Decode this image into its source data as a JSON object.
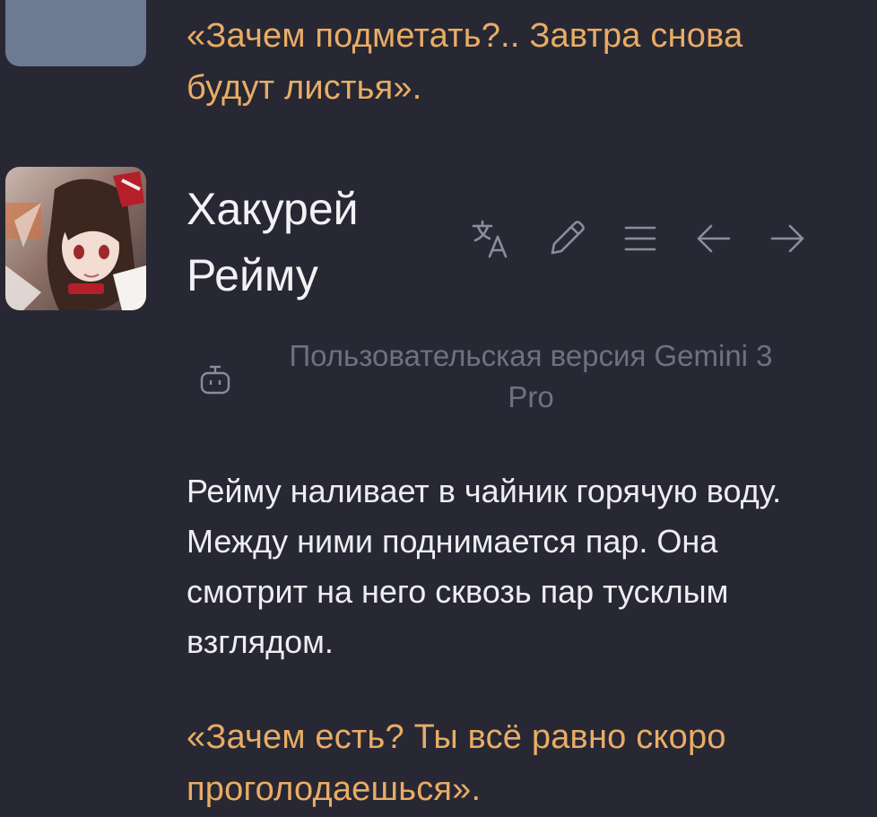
{
  "previous_message": {
    "quote": "«Зачем подметать?.. Завтра снова будут листья»."
  },
  "character": {
    "name": "Хакурей Рейму",
    "avatar": "character-portrait"
  },
  "actions": [
    {
      "id": "translate",
      "icon": "translate-icon"
    },
    {
      "id": "edit",
      "icon": "pencil-icon"
    },
    {
      "id": "menu",
      "icon": "menu-icon"
    },
    {
      "id": "prev",
      "icon": "arrow-left-icon"
    },
    {
      "id": "next",
      "icon": "arrow-right-icon"
    }
  ],
  "model": {
    "icon": "bot-icon",
    "label": "Пользовательская версия Gemini 3 Pro"
  },
  "message": {
    "narration": "Рейму наливает в чайник горячую воду. Между ними поднимается пар. Она смотрит на него сквозь пар тусклым взглядом.",
    "quote": "«Зачем есть? Ты всё равно скоро проголодаешься»."
  },
  "colors": {
    "background": "#272833",
    "quote": "#e9ac66",
    "text": "#eeeef2",
    "muted": "#6e7183",
    "icon": "#8a8d9c"
  }
}
